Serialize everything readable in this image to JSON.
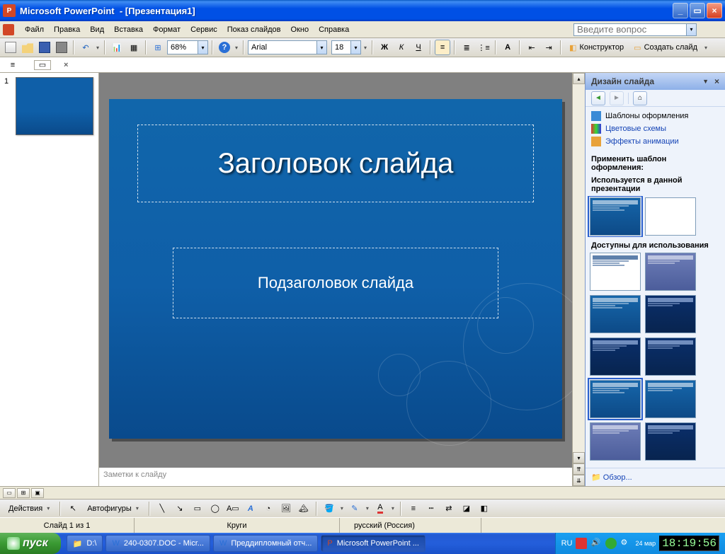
{
  "titlebar": {
    "app": "Microsoft PowerPoint",
    "doc": "[Презентация1]"
  },
  "menu": {
    "file": "Файл",
    "edit": "Правка",
    "view": "Вид",
    "insert": "Вставка",
    "format": "Формат",
    "tools": "Сервис",
    "slideshow": "Показ слайдов",
    "window": "Окно",
    "help": "Справка",
    "ask": "Введите вопрос"
  },
  "std": {
    "zoom": "68%",
    "font": "Arial",
    "size": "18"
  },
  "format": {
    "designer": "Конструктор",
    "newslide": "Создать слайд"
  },
  "thumbs": {
    "n1": "1"
  },
  "slide": {
    "title": "Заголовок слайда",
    "subtitle": "Подзаголовок слайда"
  },
  "notes": {
    "placeholder": "Заметки к слайду"
  },
  "taskpane": {
    "title": "Дизайн слайда",
    "l1": "Шаблоны оформления",
    "l2": "Цветовые схемы",
    "l3": "Эффекты анимации",
    "apply": "Применить шаблон оформления:",
    "used": "Используется в данной презентации",
    "avail": "Доступны для использования",
    "browse": "Обзор..."
  },
  "draw": {
    "actions": "Действия",
    "autoshapes": "Автофигуры"
  },
  "status": {
    "slide": "Слайд 1 из 1",
    "theme": "Круги",
    "lang": "русский (Россия)"
  },
  "taskbar": {
    "start": "пуск",
    "t1": "D:\\",
    "t2": "240-0307.DOC - Micr...",
    "t3": "Преддипломный отч...",
    "t4": "Microsoft PowerPoint ...",
    "lang": "RU",
    "date": "24 мар",
    "time": "18:19:56"
  }
}
